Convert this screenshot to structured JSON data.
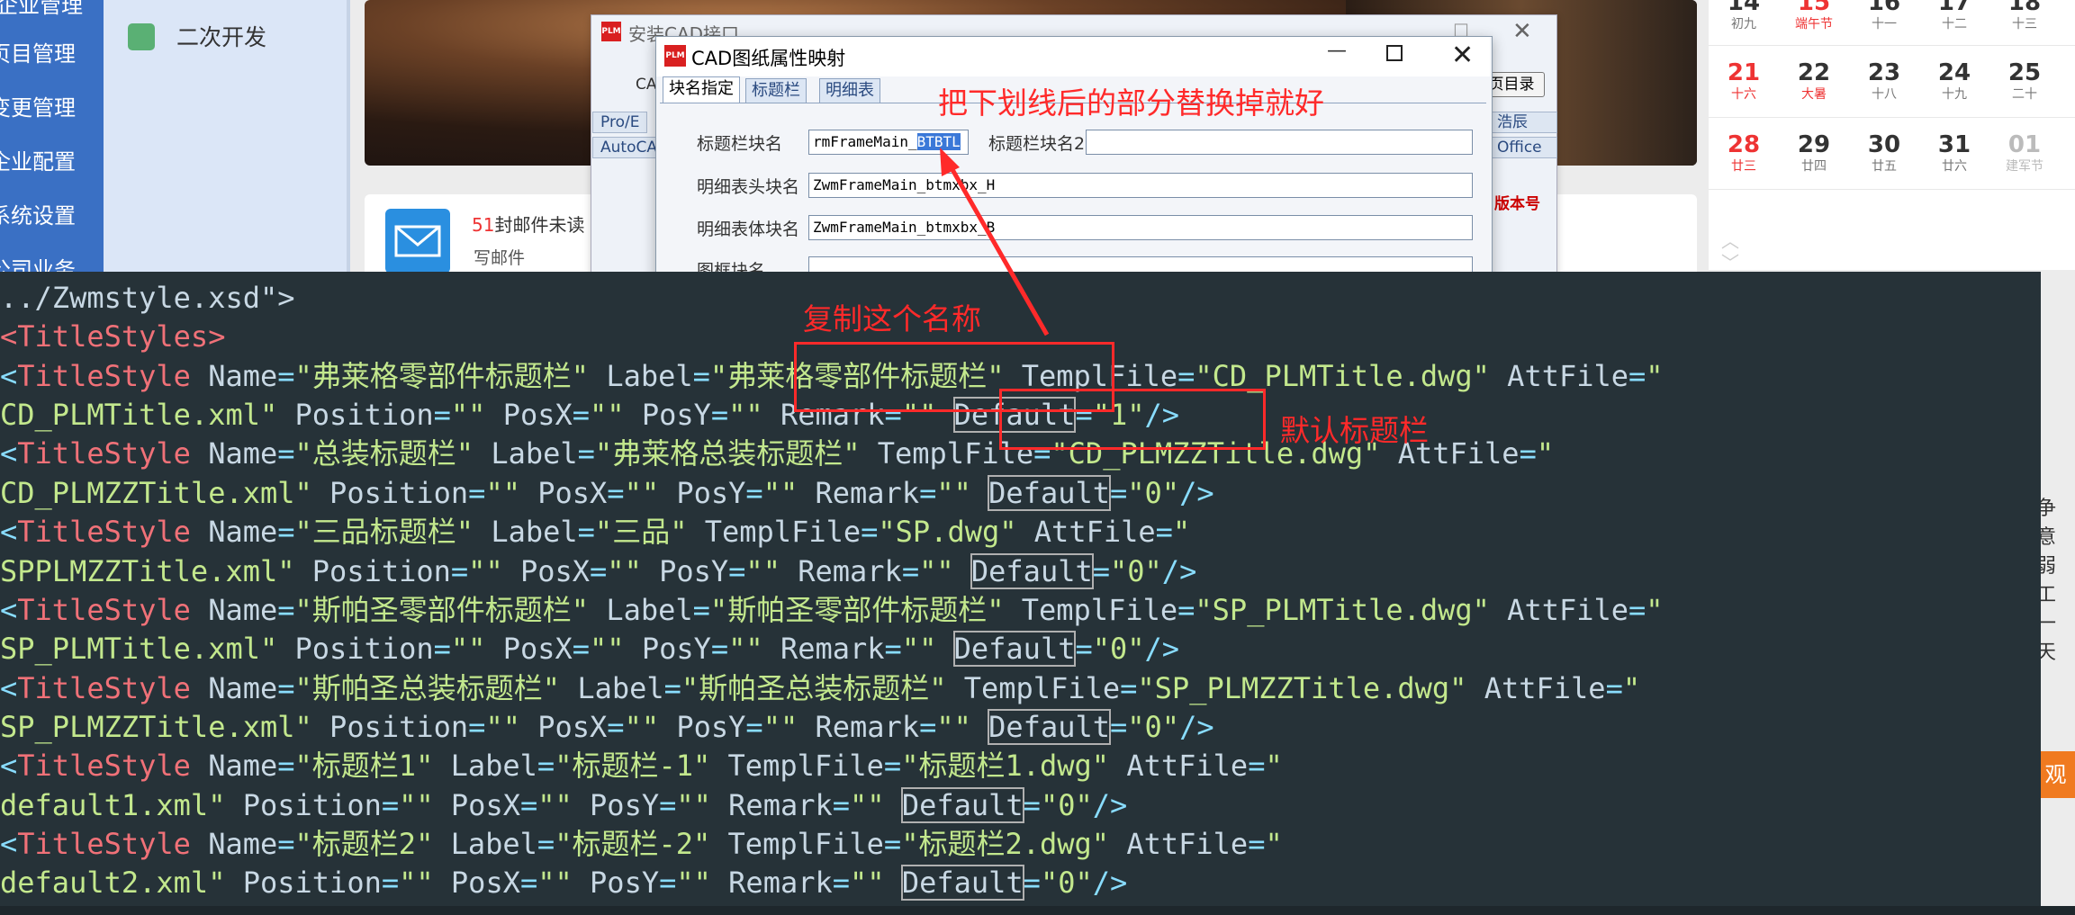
{
  "left_nav": {
    "items": [
      "页目管理",
      "变更管理",
      "企业配置",
      "系统设置",
      "公司业务"
    ],
    "top_partial": "企业管理"
  },
  "subnav": {
    "label": "二次开发"
  },
  "mail": {
    "count": "51",
    "text": "封邮件未读",
    "write": "写邮件"
  },
  "calendar": {
    "rows": [
      [
        {
          "d": "14",
          "s": "初九"
        },
        {
          "d": "15",
          "s": "端午节",
          "red": true
        },
        {
          "d": "16",
          "s": "十一"
        },
        {
          "d": "17",
          "s": "十二"
        },
        {
          "d": "18",
          "s": "十三"
        }
      ],
      [
        {
          "d": "21",
          "s": "十六",
          "red": true
        },
        {
          "d": "22",
          "s": "大暑",
          "sred": true
        },
        {
          "d": "23",
          "s": "十八"
        },
        {
          "d": "24",
          "s": "十九"
        },
        {
          "d": "25",
          "s": "二十"
        }
      ],
      [
        {
          "d": "28",
          "s": "廿三",
          "red": true
        },
        {
          "d": "29",
          "s": "廿四"
        },
        {
          "d": "30",
          "s": "廿五"
        },
        {
          "d": "31",
          "s": "廿六"
        },
        {
          "d": "01",
          "s": "建军节",
          "grey": true
        }
      ]
    ]
  },
  "right_snip": {
    "lines": [
      "争意",
      "弱工",
      "一天"
    ],
    "orange": "观"
  },
  "bg_window": {
    "title": "安装CAD接口",
    "ca_label": "CA",
    "tabs_left": [
      "Pro/E",
      "AutoCA"
    ],
    "tabs_right": [
      "浩辰",
      "Office"
    ],
    "dir_button": "页目录",
    "version_label": "版本号"
  },
  "dialog": {
    "title": "CAD图纸属性映射",
    "tabs": [
      "块名指定",
      "标题栏",
      "明细表"
    ],
    "fields": {
      "title_block_label": "标题栏块名",
      "title_block_value_pre": "rmFrameMain_",
      "title_block_value_sel": "BTBTL",
      "title_block2_label": "标题栏块名2",
      "title_block2_value": "",
      "detail_head_label": "明细表头块名",
      "detail_head_value": "ZwmFrameMain_btmxbx_H",
      "detail_body_label": "明细表体块名",
      "detail_body_value": "ZwmFrameMain_btmxbx_B",
      "frame_block_label": "图框块名"
    }
  },
  "editor": {
    "first_line": "../Zwmstyle.xsd\">",
    "root_tag": "<TitleStyles>",
    "styles": [
      {
        "name": "弗莱格零部件标题栏",
        "label": "弗莱格零部件标题栏",
        "templ": "CD_PLMTitle.dwg",
        "att": "CD_PLMTitle.xml",
        "default": "1"
      },
      {
        "name": "总装标题栏",
        "label": "弗莱格总装标题栏",
        "templ": "CD_PLMZZTitle.dwg",
        "att": "CD_PLMZZTitle.xml",
        "default": "0"
      },
      {
        "name": "三品标题栏",
        "label": "三品",
        "templ": "SP.dwg",
        "att": "SPPLMZZTitle.xml",
        "default": "0"
      },
      {
        "name": "斯帕圣零部件标题栏",
        "label": "斯帕圣零部件标题栏",
        "templ": "SP_PLMTitle.dwg",
        "att": "SP_PLMTitle.xml",
        "default": "0"
      },
      {
        "name": "斯帕圣总装标题栏",
        "label": "斯帕圣总装标题栏",
        "templ": "SP_PLMZZTitle.dwg",
        "att": "SP_PLMZZTitle.xml",
        "default": "0"
      },
      {
        "name": "标题栏1",
        "label": "标题栏-1",
        "templ": "标题栏1.dwg",
        "att": "default1.xml",
        "default": "0"
      },
      {
        "name": "标题栏2",
        "label": "标题栏-2",
        "templ": "标题栏2.dwg",
        "att": "default2.xml",
        "default": "0"
      }
    ]
  },
  "annotations": {
    "replace_hint": "把下划线后的部分替换掉就好",
    "copy_hint": "复制这个名称",
    "default_hint": "默认标题栏"
  },
  "colors": {
    "annotation": "#ff2a2a",
    "editor_bg": "#263238",
    "nav_blue": "#3a70c4"
  }
}
